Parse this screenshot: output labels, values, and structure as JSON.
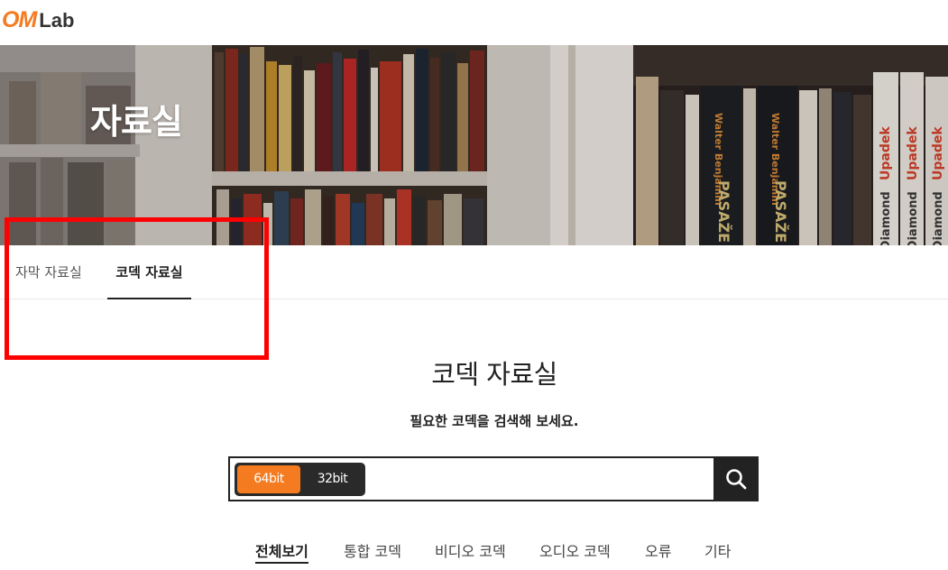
{
  "header": {
    "logo_om": "OM",
    "logo_lab": "Lab"
  },
  "hero": {
    "title": "자료실"
  },
  "tabs": [
    {
      "label": "자막 자료실",
      "active": false
    },
    {
      "label": "코덱 자료실",
      "active": true
    }
  ],
  "section": {
    "title": "코덱 자료실",
    "subtitle": "필요한 코덱을 검색해 보세요."
  },
  "search": {
    "bit_options": [
      {
        "label": "64bit",
        "selected": true
      },
      {
        "label": "32bit",
        "selected": false
      }
    ],
    "value": "",
    "placeholder": ""
  },
  "categories": [
    {
      "label": "전체보기",
      "active": true
    },
    {
      "label": "통합 코덱",
      "active": false
    },
    {
      "label": "비디오 코덱",
      "active": false
    },
    {
      "label": "오디오 코덱",
      "active": false
    },
    {
      "label": "오류",
      "active": false
    },
    {
      "label": "기타",
      "active": false
    }
  ],
  "colors": {
    "accent": "#f47b20",
    "dark": "#222222",
    "highlight": "#ff0000"
  },
  "icons": {
    "search_button": "search-icon"
  },
  "hero_book_spines": [
    "Walter Benjamin",
    "PASAŽE",
    "Walter Benjamin",
    "PASAŽE",
    "Jared Diamond",
    "Upadek",
    "Jared Diamond",
    "Upadek",
    "Jared Diamond",
    "Upadek"
  ]
}
